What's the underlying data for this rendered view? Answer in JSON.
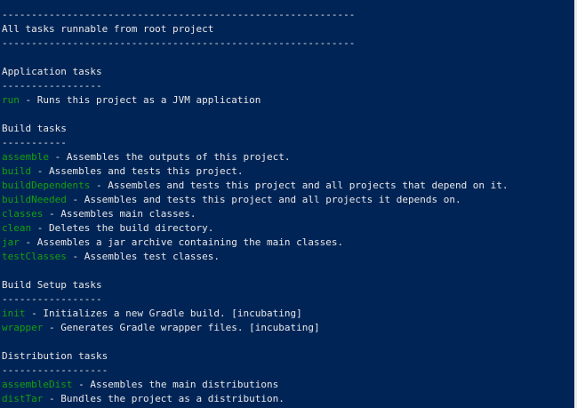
{
  "console": {
    "lines": [
      {
        "text": "------------------------------------------------------------"
      },
      {
        "text": "All tasks runnable from root project"
      },
      {
        "text": "------------------------------------------------------------"
      },
      {
        "text": ""
      },
      {
        "text": "Application tasks"
      },
      {
        "text": "-----------------"
      },
      {
        "task": "run",
        "desc": " - Runs this project as a JVM application"
      },
      {
        "text": ""
      },
      {
        "text": "Build tasks"
      },
      {
        "text": "-----------"
      },
      {
        "task": "assemble",
        "desc": " - Assembles the outputs of this project."
      },
      {
        "task": "build",
        "desc": " - Assembles and tests this project."
      },
      {
        "task": "buildDependents",
        "desc": " - Assembles and tests this project and all projects that depend on it."
      },
      {
        "task": "buildNeeded",
        "desc": " - Assembles and tests this project and all projects it depends on."
      },
      {
        "task": "classes",
        "desc": " - Assembles main classes."
      },
      {
        "task": "clean",
        "desc": " - Deletes the build directory."
      },
      {
        "task": "jar",
        "desc": " - Assembles a jar archive containing the main classes."
      },
      {
        "task": "testClasses",
        "desc": " - Assembles test classes."
      },
      {
        "text": ""
      },
      {
        "text": "Build Setup tasks"
      },
      {
        "text": "-----------------"
      },
      {
        "task": "init",
        "desc": " - Initializes a new Gradle build. [incubating]"
      },
      {
        "task": "wrapper",
        "desc": " - Generates Gradle wrapper files. [incubating]"
      },
      {
        "text": ""
      },
      {
        "text": "Distribution tasks"
      },
      {
        "text": "------------------"
      },
      {
        "task": "assembleDist",
        "desc": " - Assembles the main distributions"
      },
      {
        "task": "distTar",
        "desc": " - Bundles the project as a distribution."
      }
    ]
  },
  "colors": {
    "background": "#012456",
    "text": "#e8e8e8",
    "task_name": "#13a10e"
  }
}
